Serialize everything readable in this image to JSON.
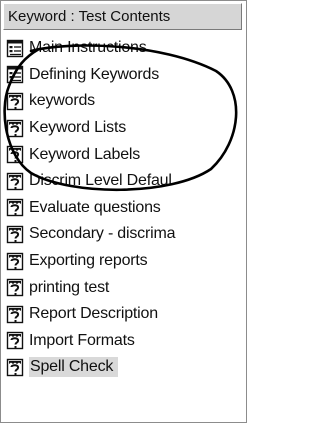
{
  "panel": {
    "header": "Keyword : Test Contents",
    "items": [
      {
        "label": "Main Instructions",
        "icon": "document-list-icon"
      },
      {
        "label": "Defining Keywords",
        "icon": "document-list-icon"
      },
      {
        "label": "keywords",
        "icon": "question-page-icon"
      },
      {
        "label": "Keyword Lists",
        "icon": "question-page-icon"
      },
      {
        "label": "Keyword Labels",
        "icon": "question-page-icon"
      },
      {
        "label": "Discrim Level Defaul",
        "icon": "question-page-icon"
      },
      {
        "label": "Evaluate questions",
        "icon": "question-page-icon"
      },
      {
        "label": "Secondary - discrima",
        "icon": "question-page-icon"
      },
      {
        "label": "Exporting reports",
        "icon": "question-page-icon"
      },
      {
        "label": "printing test",
        "icon": "question-page-icon"
      },
      {
        "label": "Report Description",
        "icon": "question-page-icon"
      },
      {
        "label": "Import Formats",
        "icon": "question-page-icon"
      },
      {
        "label": "Spell Check",
        "icon": "question-page-icon",
        "selected": true
      }
    ],
    "annotation": {
      "shape": "hand-drawn ellipse",
      "color": "#000000"
    }
  }
}
